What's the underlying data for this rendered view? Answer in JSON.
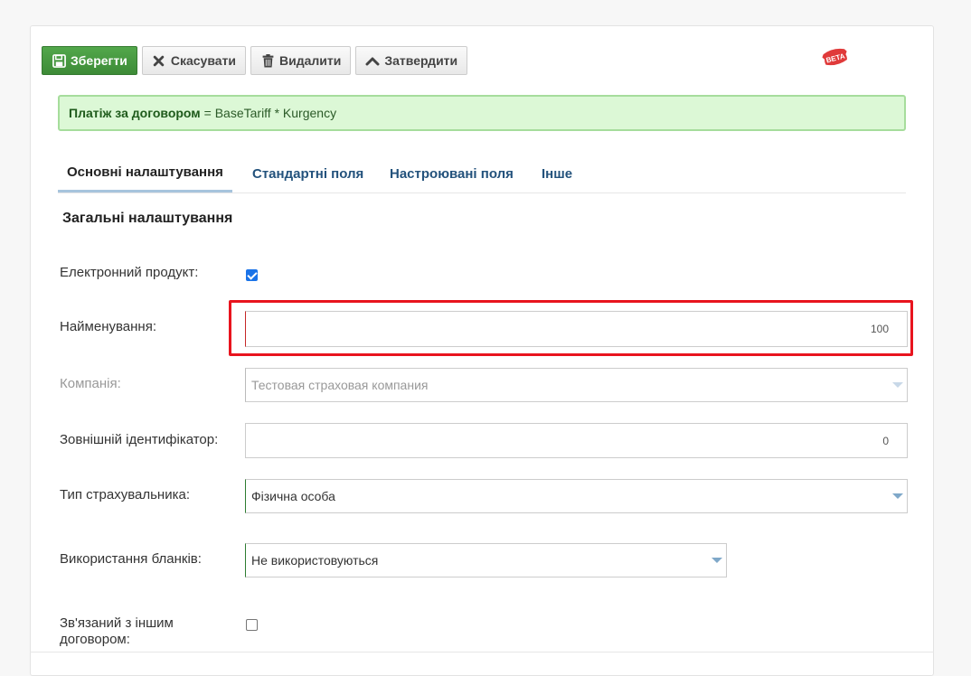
{
  "toolbar": {
    "save_label": "Зберегти",
    "cancel_label": "Скасувати",
    "delete_label": "Видалити",
    "approve_label": "Затвердити"
  },
  "badge": {
    "text": "BETA"
  },
  "formula": {
    "label": "Платіж за договором",
    "expression": "= BaseTariff * Kurgency"
  },
  "tabs": [
    {
      "label": "Основні налаштування",
      "active": true
    },
    {
      "label": "Стандартні поля"
    },
    {
      "label": "Настроювані поля"
    },
    {
      "label": "Інше"
    }
  ],
  "section": {
    "title": "Загальні налаштування"
  },
  "form": {
    "electronic_product": {
      "label": "Електронний продукт:",
      "checked": true
    },
    "name": {
      "label": "Найменування:",
      "value": "",
      "counter": "100"
    },
    "company": {
      "label": "Компанія:",
      "value": "Тестовая страховая компания"
    },
    "external_id": {
      "label": "Зовнішній ідентифікатор:",
      "value": "",
      "counter": "0"
    },
    "insurer_type": {
      "label": "Тип страхувальника:",
      "value": "Фізична особа"
    },
    "blanks_usage": {
      "label": "Використання бланків:",
      "value": "Не використовуються"
    },
    "linked_contract": {
      "label": "Зв'язаний з іншим договором:",
      "checked": false
    }
  },
  "colors": {
    "save_green": "#3d8b37",
    "link_blue": "#23527c",
    "highlight_red": "#e8141e",
    "formula_bg": "#dcf8d6"
  }
}
